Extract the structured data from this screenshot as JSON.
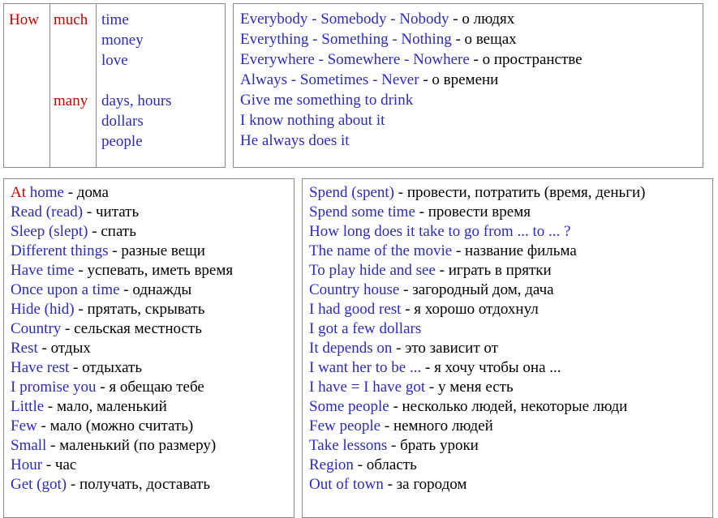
{
  "colors": {
    "english": "#2b2bbf",
    "highlight": "#cc0000",
    "translation": "#000000",
    "border": "#8a8a8a",
    "background": "#ffffff"
  },
  "quantifier_table": {
    "question_word": "How",
    "rows": [
      {
        "quantifier": "much",
        "items": [
          "time",
          "money",
          "love"
        ]
      },
      {
        "quantifier": "many",
        "items": [
          "days, hours",
          "dollars",
          "people"
        ]
      }
    ]
  },
  "pronoun_box": {
    "lines": [
      {
        "english": "Everybody - Somebody - Nobody",
        "sep": " - ",
        "translation": "о людях"
      },
      {
        "english": "Everything - Something - Nothing",
        "sep": " - ",
        "translation": "о вещах"
      },
      {
        "english": "Everywhere - Somewhere - Nowhere",
        "sep": " - ",
        "translation": "о пространстве"
      },
      {
        "english": "Always - Sometimes - Never",
        "sep": " - ",
        "translation": "о времени"
      },
      {
        "english": "Give me something to drink",
        "sep": "",
        "translation": ""
      },
      {
        "english": "I know nothing about it",
        "sep": "",
        "translation": ""
      },
      {
        "english": "He always does it",
        "sep": "",
        "translation": ""
      }
    ]
  },
  "vocab_left": {
    "lines": [
      {
        "english": "At home",
        "sep": " - ",
        "translation": "дома",
        "highlight_first": "At"
      },
      {
        "english": "Read (read)",
        "sep": " - ",
        "translation": "читать"
      },
      {
        "english": "Sleep (slept)",
        "sep": " - ",
        "translation": "спать"
      },
      {
        "english": "Different things",
        "sep": " - ",
        "translation": "разные вещи"
      },
      {
        "english": "Have time",
        "sep": " - ",
        "translation": "успевать, иметь время"
      },
      {
        "english": "Once upon a time",
        "sep": " - ",
        "translation": "однажды"
      },
      {
        "english": "Hide (hid)",
        "sep": " - ",
        "translation": "прятать, скрывать"
      },
      {
        "english": "Country",
        "sep": " - ",
        "translation": "сельская местность"
      },
      {
        "english": "Rest",
        "sep": " - ",
        "translation": "отдых"
      },
      {
        "english": "Have rest",
        "sep": " - ",
        "translation": "отдыхать"
      },
      {
        "english": "I promise you",
        "sep": " - ",
        "translation": "я обещаю тебе"
      },
      {
        "english": "Little",
        "sep": " - ",
        "translation": "мало, маленький"
      },
      {
        "english": "Few",
        "sep": " - ",
        "translation": "мало (можно считать)"
      },
      {
        "english": "Small",
        "sep": " - ",
        "translation": "маленький (по размеру)"
      },
      {
        "english": "Hour",
        "sep": " - ",
        "translation": "час"
      },
      {
        "english": "Get (got)",
        "sep": " - ",
        "translation": "получать, доставать"
      }
    ]
  },
  "vocab_right": {
    "lines": [
      {
        "english": "Spend (spent)",
        "sep": " - ",
        "translation": "провести, потратить (время, деньги)"
      },
      {
        "english": "Spend some time",
        "sep": " - ",
        "translation": "провести время"
      },
      {
        "english": "How long does it take to go from ... to ... ?",
        "sep": "",
        "translation": ""
      },
      {
        "english": "The name of the movie",
        "sep": " - ",
        "translation": "название фильма"
      },
      {
        "english": "To play hide and see",
        "sep": " - ",
        "translation": "играть в прятки"
      },
      {
        "english": "Country house",
        "sep": " - ",
        "translation": "загородный дом, дача"
      },
      {
        "english": "I had good rest",
        "sep": " - ",
        "translation": "я хорошо отдохнул"
      },
      {
        "english": "I got a few dollars",
        "sep": "",
        "translation": ""
      },
      {
        "english": "It depends on",
        "sep": " - ",
        "translation": "это зависит от"
      },
      {
        "english": "I want her to be ...",
        "sep": " - ",
        "translation": "я хочу чтобы она ..."
      },
      {
        "english": "I have = I have got",
        "sep": " - ",
        "translation": "у меня есть"
      },
      {
        "english": "Some people",
        "sep": " - ",
        "translation": "несколько людей, некоторые люди"
      },
      {
        "english": "Few people",
        "sep": " - ",
        "translation": "немного людей"
      },
      {
        "english": "Take lessons",
        "sep": " - ",
        "translation": "брать уроки"
      },
      {
        "english": "Region",
        "sep": " - ",
        "translation": "область"
      },
      {
        "english": "Out of town",
        "sep": " - ",
        "translation": "за городом"
      }
    ]
  }
}
